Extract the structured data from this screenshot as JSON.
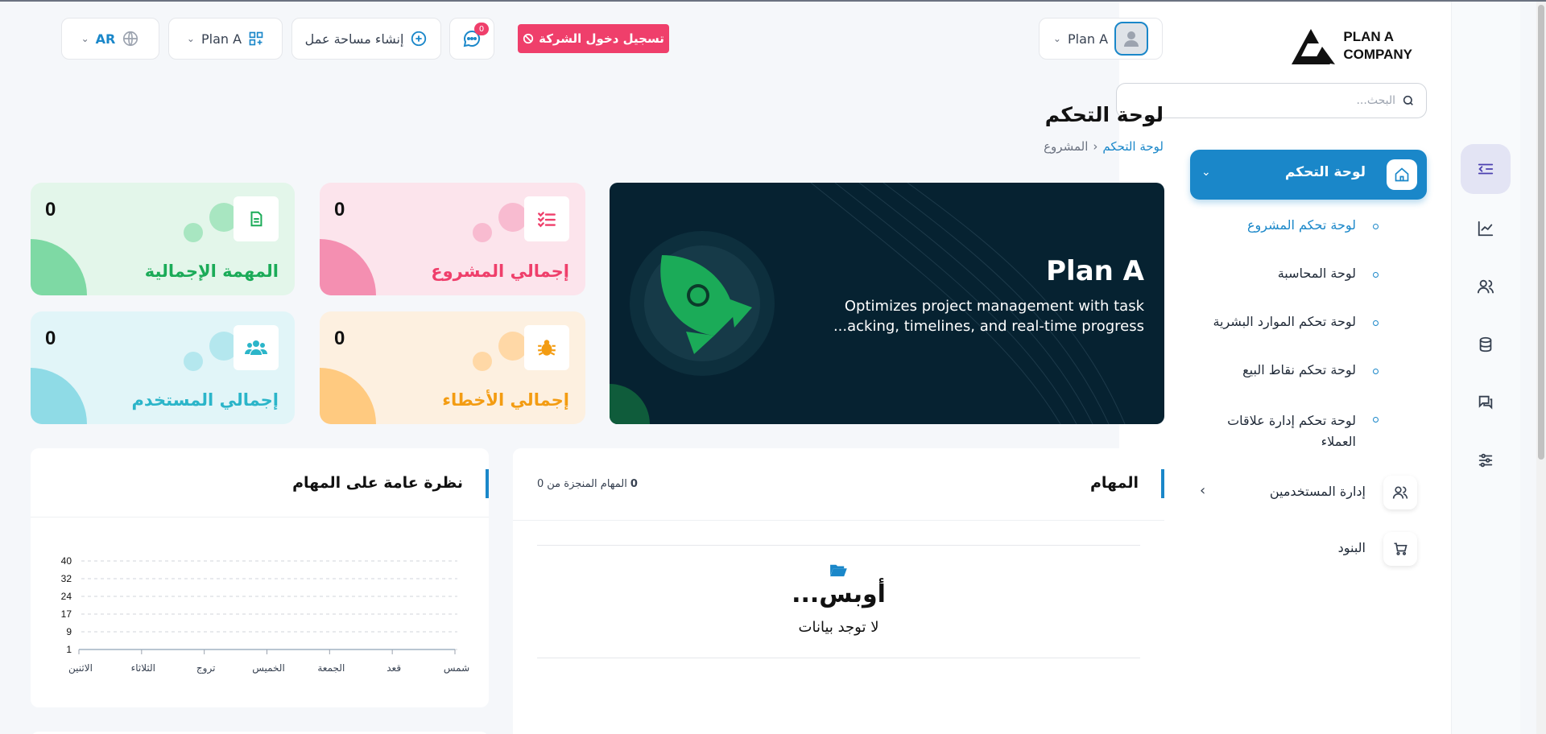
{
  "logo": {
    "line1": "PLAN A",
    "line2": "COMPANY"
  },
  "search": {
    "placeholder": "البحث..."
  },
  "sidebar": {
    "dashboard_label": "لوحة التحكم",
    "sub_items": [
      "لوحة تحكم المشروع",
      "لوحة المحاسبة",
      "لوحة تحكم الموارد البشرية",
      "لوحة تحكم نقاط البيع",
      "لوحة تحكم إدارة علاقات العملاء"
    ],
    "users_label": "إدارة المستخدمين",
    "items_label": "البنود"
  },
  "header": {
    "workspace_user": "Plan A",
    "company_login": "تسجيل دخول الشركة",
    "chat_badge": "0",
    "create_workspace": "إنشاء مساحة عمل",
    "workspace_select": "Plan A",
    "language": "AR"
  },
  "page": {
    "title": "لوحة التحكم",
    "breadcrumb_current": "لوحة التحكم",
    "breadcrumb_parent": "المشروع"
  },
  "hero": {
    "title": "Plan A",
    "line1": "Optimizes project management with task",
    "line2": "...acking, timelines, and real-time progress"
  },
  "stats": {
    "projects": {
      "label": "إجمالي المشروع",
      "value": "0"
    },
    "tasks": {
      "label": "المهمة الإجمالية",
      "value": "0"
    },
    "bugs": {
      "label": "إجمالي الأخطاء",
      "value": "0"
    },
    "users": {
      "label": "إجمالي المستخدم",
      "value": "0"
    }
  },
  "tasks_panel": {
    "title": "المهام",
    "done_label": "المهام المنجزة من",
    "done_count": "0",
    "done_total": "0",
    "empty_title": "...أوبس",
    "empty_sub": "لا توجد بيانات"
  },
  "overview_panel": {
    "title": "نظرة عامة على المهام"
  },
  "colors": {
    "primary": "#1a87c9",
    "pink": "#ef3f6b",
    "green": "#1bab58",
    "orange": "#f39c12",
    "cyan": "#2bb5c9",
    "hero_bg": "#062231"
  },
  "chart_data": {
    "type": "line",
    "categories": [
      "الاثنين",
      "الثلاثاء",
      "تروج",
      "الخميس",
      "الجمعة",
      "قعد",
      "شمس"
    ],
    "series": [
      {
        "values": [
          0,
          0,
          0,
          0,
          0,
          0,
          0
        ]
      }
    ],
    "yticks": [
      "40",
      "32",
      "24",
      "17",
      "9",
      "1"
    ],
    "ylim": [
      1,
      40
    ],
    "grid": true,
    "legend": "none"
  }
}
